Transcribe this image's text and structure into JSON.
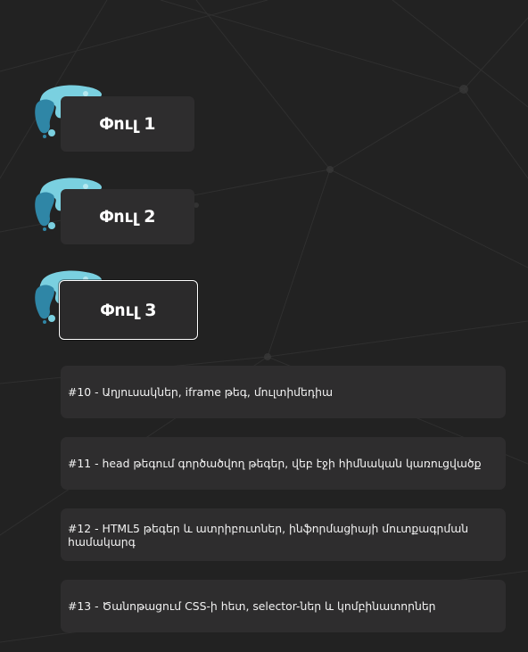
{
  "phases": [
    {
      "label": "Փուլ 1",
      "active": false
    },
    {
      "label": "Փուլ 2",
      "active": false
    },
    {
      "label": "Փուլ 3",
      "active": true
    }
  ],
  "lessons": [
    {
      "text": "#10 - Աղյուսակներ, iframe թեգ, մուլտիմեդիա"
    },
    {
      "text": "#11 - head թեգում գործածվող թեգեր, վեբ էջի հիմնական կառուցվածք"
    },
    {
      "text": "#12 - HTML5 թեգեր և ատրիբուտներ, ինֆորմացիայի մուտքագրման համակարգ"
    },
    {
      "text": "#13 - Ծանոթացում CSS-ի հետ, selector-ներ և կոմբինատորներ"
    }
  ],
  "colors": {
    "background": "#222222",
    "card": "#2e2d2e",
    "blob_light": "#7ad0e0",
    "blob_dark": "#2f86a6"
  },
  "icons": {
    "phase_blob": "paint-splash-icon"
  }
}
